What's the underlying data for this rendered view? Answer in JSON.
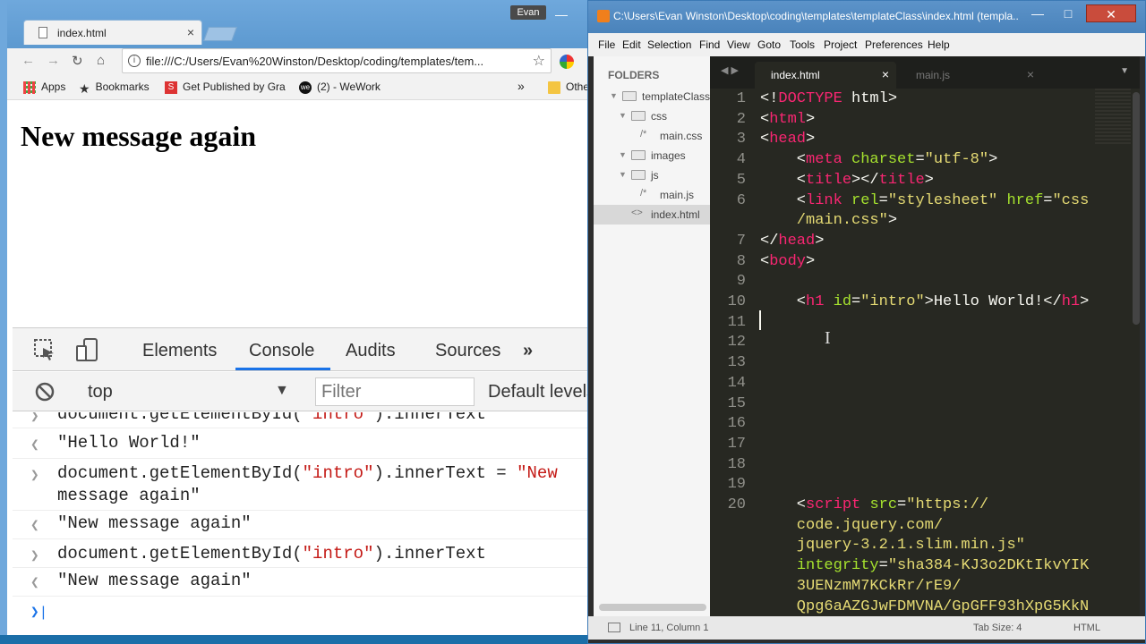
{
  "chrome": {
    "tab_title": "index.html",
    "user_badge": "Evan",
    "url": "file:///C:/Users/Evan%20Winston/Desktop/coding/templates/tem...",
    "bookmarks": [
      "Apps",
      "Bookmarks",
      "Get Published by Gra",
      "(2) - WeWork"
    ],
    "bookmarks_overflow": "»",
    "other_bookmarks": "Othe",
    "page_heading": "New message again"
  },
  "devtools": {
    "tabs": [
      "Elements",
      "Console",
      "Audits",
      "Sources"
    ],
    "more_tabs": "»",
    "context": "top",
    "filter_placeholder": "Filter",
    "levels": "Default levels",
    "log": [
      {
        "kind": "input",
        "pre": "document.getElementById(",
        "str": "\"intro\"",
        "post": ").innerText"
      },
      {
        "kind": "output",
        "str": "\"Hello World!\""
      },
      {
        "kind": "input",
        "pre": "document.getElementById(",
        "str": "\"intro\"",
        "post": ").innerText = ",
        "str2": "\"New",
        "line2": "message again\""
      },
      {
        "kind": "output",
        "str": "\"New message again\""
      },
      {
        "kind": "input",
        "pre": "document.getElementById(",
        "str": "\"intro\"",
        "post": ").innerText"
      },
      {
        "kind": "output",
        "str": "\"New message again\""
      }
    ]
  },
  "sublime": {
    "title": "C:\\Users\\Evan Winston\\Desktop\\coding\\templates\\templateClass\\index.html (templa...",
    "menu": [
      "File",
      "Edit",
      "Selection",
      "Find",
      "View",
      "Goto",
      "Tools",
      "Project",
      "Preferences",
      "Help"
    ],
    "sidebar": {
      "heading": "FOLDERS",
      "tree": [
        {
          "name": "templateClass",
          "type": "folder",
          "level": 0
        },
        {
          "name": "css",
          "type": "folder",
          "level": 1
        },
        {
          "name": "main.css",
          "type": "file",
          "glyph": "/*",
          "level": 2
        },
        {
          "name": "images",
          "type": "folder",
          "level": 1
        },
        {
          "name": "js",
          "type": "folder",
          "level": 1
        },
        {
          "name": "main.js",
          "type": "file",
          "glyph": "/*",
          "level": 2
        },
        {
          "name": "index.html",
          "type": "file",
          "glyph": "<>",
          "level": 1
        }
      ]
    },
    "tabs": [
      {
        "label": "index.html",
        "active": true
      },
      {
        "label": "main.js",
        "active": false
      }
    ],
    "status": {
      "position": "Line 11, Column 1",
      "tab_size": "Tab Size: 4",
      "syntax": "HTML"
    },
    "code": [
      {
        "n": "1",
        "parts": [
          [
            "p",
            "<!"
          ],
          [
            "tg",
            "DOCTYPE"
          ],
          [
            "p",
            " html>"
          ]
        ]
      },
      {
        "n": "2",
        "parts": [
          [
            "p",
            "<"
          ],
          [
            "tg",
            "html"
          ],
          [
            "p",
            ">"
          ]
        ]
      },
      {
        "n": "3",
        "parts": [
          [
            "p",
            "<"
          ],
          [
            "tg",
            "head"
          ],
          [
            "p",
            ">"
          ]
        ]
      },
      {
        "n": "4",
        "parts": [
          [
            "p",
            "    <"
          ],
          [
            "tg",
            "meta"
          ],
          [
            "p",
            " "
          ],
          [
            "at",
            "charset"
          ],
          [
            "p",
            "="
          ],
          [
            "sv",
            "\"utf-8\""
          ],
          [
            "p",
            ">"
          ]
        ]
      },
      {
        "n": "5",
        "parts": [
          [
            "p",
            "    <"
          ],
          [
            "tg",
            "title"
          ],
          [
            "p",
            "></"
          ],
          [
            "tg",
            "title"
          ],
          [
            "p",
            ">"
          ]
        ]
      },
      {
        "n": "6",
        "parts": [
          [
            "p",
            "    <"
          ],
          [
            "tg",
            "link"
          ],
          [
            "p",
            " "
          ],
          [
            "at",
            "rel"
          ],
          [
            "p",
            "="
          ],
          [
            "sv",
            "\"stylesheet\""
          ],
          [
            "p",
            " "
          ],
          [
            "at",
            "href"
          ],
          [
            "p",
            "="
          ],
          [
            "sv",
            "\"css"
          ]
        ]
      },
      {
        "n": "",
        "parts": [
          [
            "sv",
            "    /main.css\""
          ],
          [
            "p",
            ">"
          ]
        ]
      },
      {
        "n": "7",
        "parts": [
          [
            "p",
            "</"
          ],
          [
            "tg",
            "head"
          ],
          [
            "p",
            ">"
          ]
        ]
      },
      {
        "n": "8",
        "parts": [
          [
            "p",
            "<"
          ],
          [
            "tg",
            "body"
          ],
          [
            "p",
            ">"
          ]
        ]
      },
      {
        "n": "9",
        "parts": []
      },
      {
        "n": "10",
        "parts": [
          [
            "p",
            "    <"
          ],
          [
            "tg",
            "h1"
          ],
          [
            "p",
            " "
          ],
          [
            "at",
            "id"
          ],
          [
            "p",
            "="
          ],
          [
            "sv",
            "\"intro\""
          ],
          [
            "p",
            ">Hello World!</"
          ],
          [
            "tg",
            "h1"
          ],
          [
            "p",
            ">"
          ]
        ]
      },
      {
        "n": "11",
        "parts": []
      },
      {
        "n": "12",
        "parts": []
      },
      {
        "n": "13",
        "parts": []
      },
      {
        "n": "14",
        "parts": []
      },
      {
        "n": "15",
        "parts": []
      },
      {
        "n": "16",
        "parts": []
      },
      {
        "n": "17",
        "parts": []
      },
      {
        "n": "18",
        "parts": []
      },
      {
        "n": "19",
        "parts": []
      },
      {
        "n": "20",
        "parts": [
          [
            "p",
            "    <"
          ],
          [
            "tg",
            "script"
          ],
          [
            "p",
            " "
          ],
          [
            "at",
            "src"
          ],
          [
            "p",
            "="
          ],
          [
            "sv",
            "\"https://"
          ]
        ]
      },
      {
        "n": "",
        "parts": [
          [
            "sv",
            "    code.jquery.com/"
          ]
        ]
      },
      {
        "n": "",
        "parts": [
          [
            "sv",
            "    jquery-3.2.1.slim.min.js\""
          ]
        ]
      },
      {
        "n": "",
        "parts": [
          [
            "p",
            "    "
          ],
          [
            "at",
            "integrity"
          ],
          [
            "p",
            "="
          ],
          [
            "sv",
            "\"sha384-KJ3o2DKtIkvYIK"
          ]
        ]
      },
      {
        "n": "",
        "parts": [
          [
            "sv",
            "    3UENzmM7KCkRr/rE9/"
          ]
        ]
      },
      {
        "n": "",
        "parts": [
          [
            "sv",
            "    Qpg6aAZGJwFDMVNA/GpGFF93hXpG5KkN"
          ]
        ]
      }
    ]
  }
}
